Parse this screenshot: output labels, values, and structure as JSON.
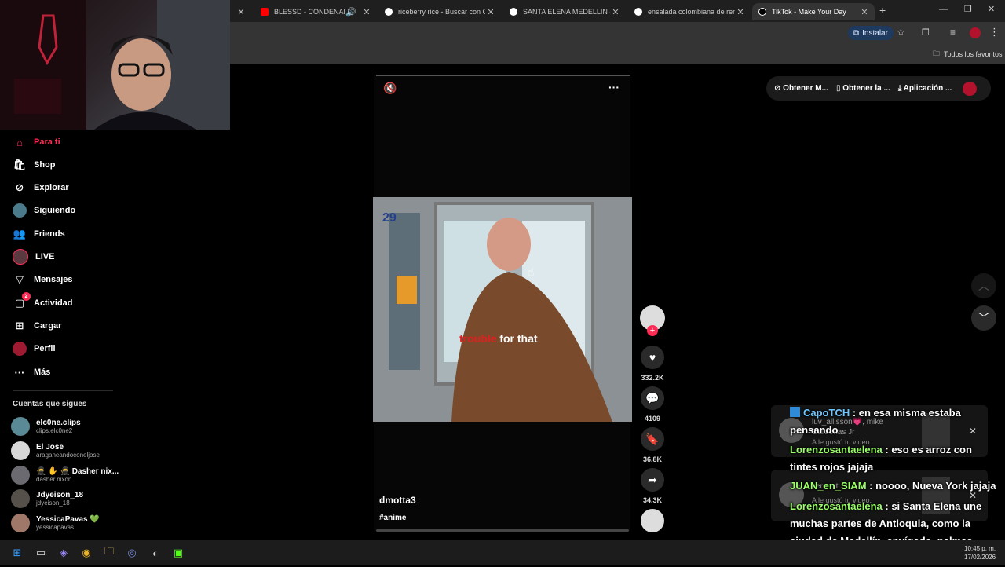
{
  "browser": {
    "tabs": [
      {
        "title": "BLESSD - CONDENADO AL",
        "favicon_color": "#ff0000",
        "audio": true
      },
      {
        "title": "riceberry rice - Buscar con Goo",
        "favicon_color": "#ffffff"
      },
      {
        "title": "SANTA ELENA MEDELLIN - Busc",
        "favicon_color": "#ffffff"
      },
      {
        "title": "ensalada colombiana de remol",
        "favicon_color": "#ffffff"
      },
      {
        "title": "TikTok - Make Your Day",
        "favicon_color": "#000000",
        "active": true
      }
    ],
    "new_tab": "+",
    "install_label": "Instalar",
    "bookmarks_label": "Todos los favoritos"
  },
  "sidebar": {
    "nav": [
      {
        "label": "Para ti",
        "icon": "home-icon",
        "active": true
      },
      {
        "label": "Shop",
        "icon": "shop-icon"
      },
      {
        "label": "Explorar",
        "icon": "compass-icon"
      },
      {
        "label": "Siguiendo",
        "icon": "following-avatar-icon"
      },
      {
        "label": "Friends",
        "icon": "friends-icon"
      },
      {
        "label": "LIVE",
        "icon": "live-avatar-icon"
      },
      {
        "label": "Mensajes",
        "icon": "send-icon"
      },
      {
        "label": "Actividad",
        "icon": "inbox-icon",
        "badge": "2"
      },
      {
        "label": "Cargar",
        "icon": "upload-icon"
      },
      {
        "label": "Perfil",
        "icon": "profile-avatar-icon"
      },
      {
        "label": "Más",
        "icon": "more-dots-icon"
      }
    ],
    "following_title": "Cuentas que sigues",
    "following": [
      {
        "name": "elc0ne.clips",
        "handle": "clips.elc0ne2"
      },
      {
        "name": "El Jose",
        "handle": "araganeandoconeljose"
      },
      {
        "name": "🥷 ✋ 🥷 Dasher nix...",
        "handle": "dasher.nixon"
      },
      {
        "name": "Jdyeison_18",
        "handle": "jdyeison_18"
      },
      {
        "name": "YessicaPavas 💚",
        "handle": "yessicapavas"
      }
    ]
  },
  "video": {
    "author": "dmotta3",
    "hashtag": "#anime",
    "caption_red": "trouble",
    "caption_white": "for that",
    "door_number": "29",
    "likes": "332.2K",
    "comments": "4109",
    "saves": "36.8K",
    "shares": "34.3K"
  },
  "topbar": {
    "btn1": "Obtener M...",
    "btn2": "Obtener la ...",
    "btn3": "Aplicación ..."
  },
  "notifications": [
    {
      "line1": "luv_allisson💗, mike",
      "line2": "Cardenas Jr",
      "line3": "A le gustó tu video."
    },
    {
      "line1": "zeroreit",
      "line2": "",
      "line3": "A le gustó tu video."
    }
  ],
  "chat": [
    {
      "user": "CapoTCH",
      "text": " : en esa misma estaba pensando",
      "color": "#6ec6ff",
      "icon": true
    },
    {
      "user": "Lorenzosantaelena",
      "text": " : eso es arroz con tintes rojos jajaja",
      "color": "#9bff6a"
    },
    {
      "user": "JUAN_en_SIAM",
      "text": " : noooo, Nueva York jajaja",
      "color": "#9bff6a"
    },
    {
      "user": "Lorenzosantaelena",
      "text": " : si Santa Elena une muchas partes de Antioquia, como la ciudad de Medellín, envígado, palmas, Rionegro, marrinilla, llano grande",
      "color": "#9bff6a"
    }
  ],
  "clock": {
    "time": "10:45 p. m.",
    "date": "17/02/2026"
  },
  "colors": {
    "accent": "#fe2c55"
  }
}
